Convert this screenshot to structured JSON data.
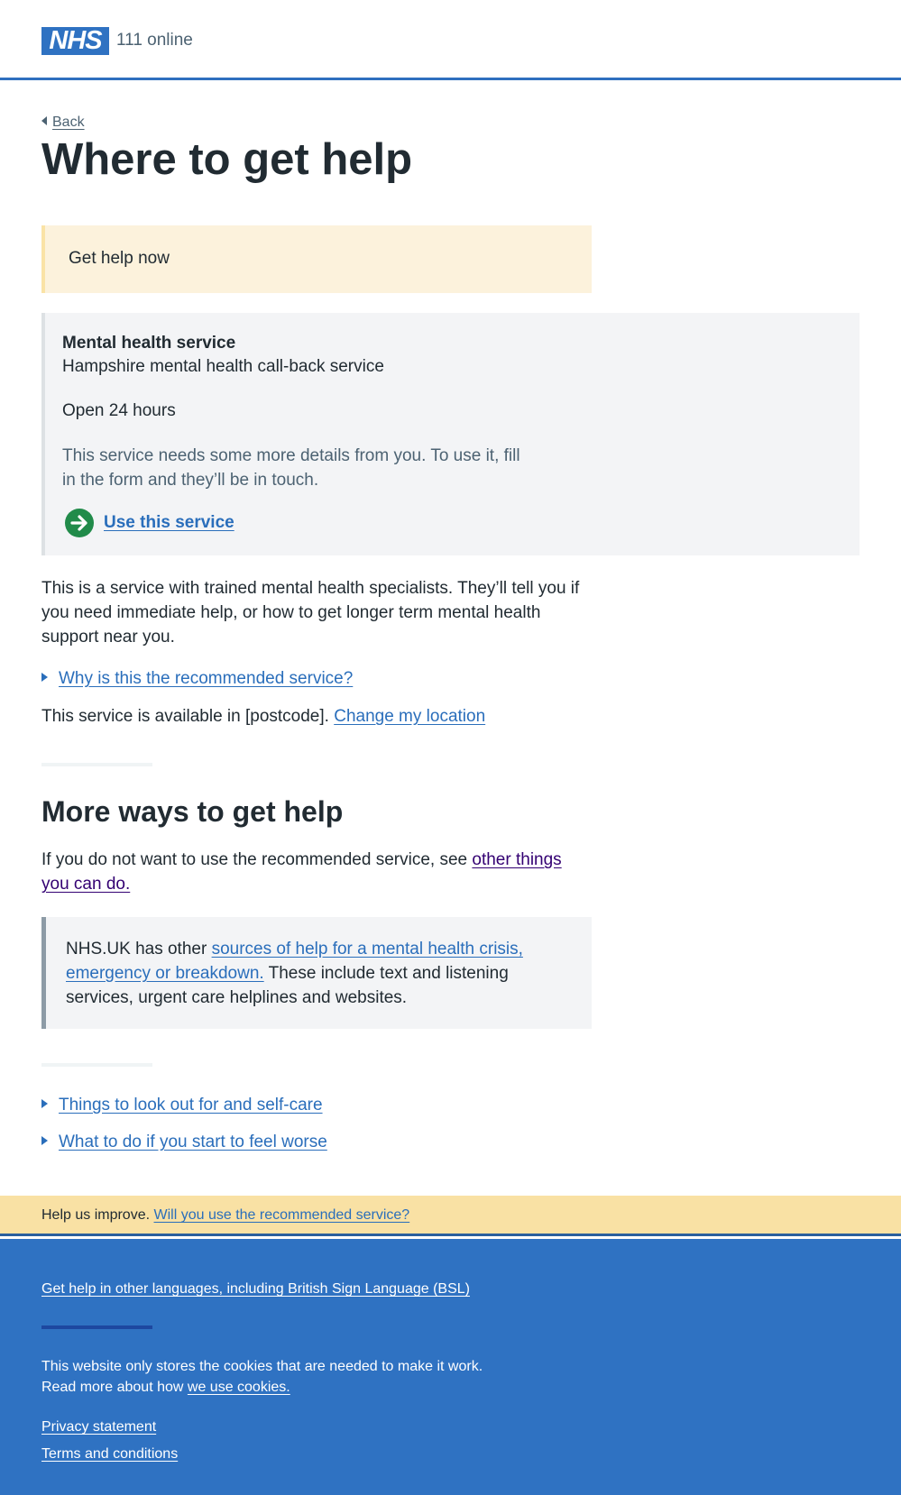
{
  "header": {
    "logo_text": "NHS",
    "service_name": "111 online"
  },
  "nav": {
    "back_label": "Back"
  },
  "page_title": "Where to get help",
  "warning_callout": {
    "text": "Get help now"
  },
  "service_card": {
    "title": "Mental health service",
    "name": "Hampshire mental health call-back service",
    "opening": "Open 24 hours",
    "note": "This service needs some more details from you. To use it, fill in the form and they’ll be in touch.",
    "action_label": "Use this service",
    "action_icon": "arrow-right-circle-icon"
  },
  "description": "This is a service with trained mental health specialists. They’ll tell you if you need immediate help, or how to get longer term mental health support near you.",
  "why_recommended": "Why is this the recommended service?",
  "availability": {
    "text": "This service is available in [postcode].",
    "change_link": "Change my location"
  },
  "more_ways": {
    "heading": "More ways to get help",
    "intro": "If you do not want to use the recommended service, see",
    "intro_link": "other things you can do."
  },
  "inset": {
    "prefix": "NHS.UK has other",
    "link": "sources of help for a mental health crisis, emergency or breakdown.",
    "suffix": "These include text and listening services, urgent care helplines and websites."
  },
  "expanders": {
    "self_care": "Things to look out for and self-care",
    "feel_worse": "What to do if you start to feel worse"
  },
  "feedback": {
    "prefix": "Help us improve.",
    "link": "Will you use the recommended service?"
  },
  "footer": {
    "languages_link": "Get help in other languages, including British Sign Language (BSL)",
    "cookies_line1": "This website only stores the cookies that are needed to make it work.",
    "cookies_line2": "Read more about how",
    "cookies_link": "we use cookies.",
    "privacy": "Privacy statement",
    "terms": "Terms and conditions"
  },
  "colors": {
    "nhs_blue": "#2f72c2",
    "link": "#2a6ebb",
    "visited_link": "#330072",
    "go_green": "#218b4a",
    "warning_bg": "#fcf2dc",
    "feedback_bg": "#f9e1a4"
  }
}
